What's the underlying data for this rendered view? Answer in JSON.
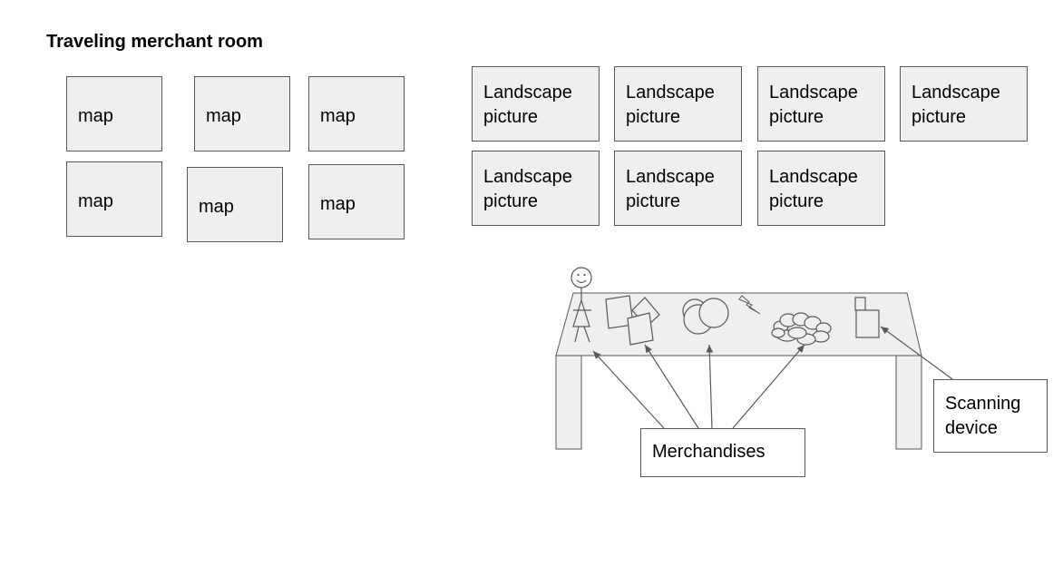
{
  "title": "Traveling merchant room",
  "maps": [
    "map",
    "map",
    "map",
    "map",
    "map",
    "map"
  ],
  "landscapes": [
    "Landscape\npicture",
    "Landscape\npicture",
    "Landscape\npicture",
    "Landscape\npicture",
    "Landscape\npicture",
    "Landscape\npicture",
    "Landscape\npicture"
  ],
  "callouts": {
    "merchandises": "Merchandises",
    "scanning_device": "Scanning\ndevice"
  },
  "colors": {
    "box_fill": "#efefef",
    "stroke": "#595959"
  }
}
